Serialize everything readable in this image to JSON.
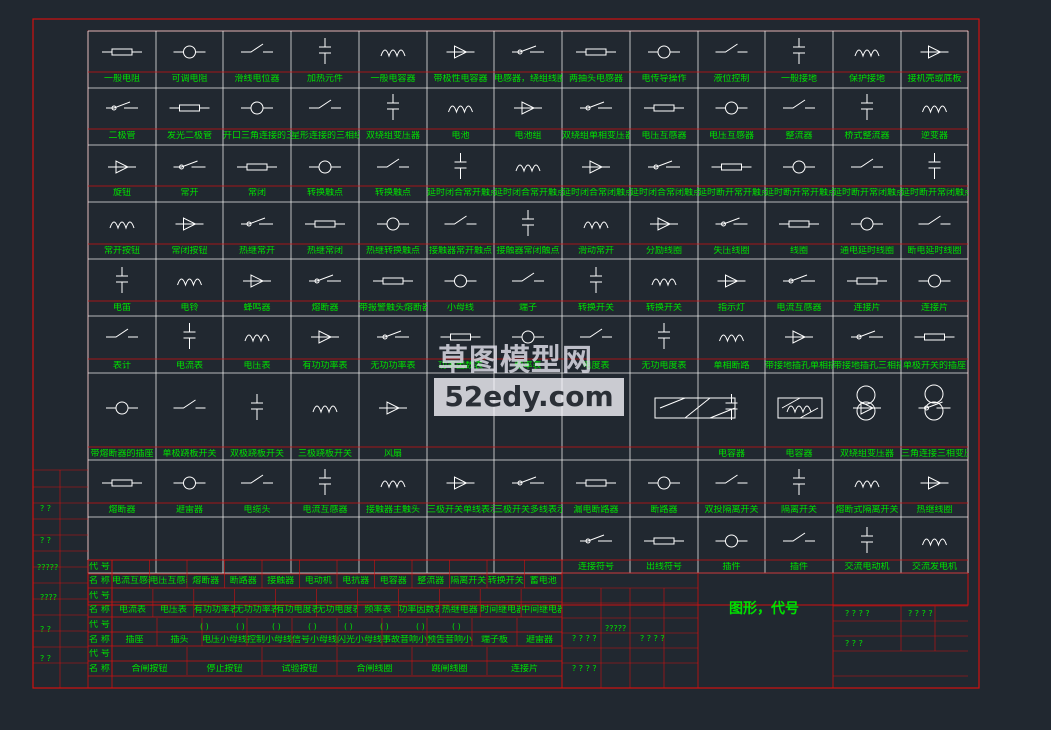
{
  "colors": {
    "background": "#212830",
    "frame": "#d01010",
    "grid": "#e8e8e8",
    "text": "#00e000",
    "symbol": "#ffffff"
  },
  "grid": {
    "rows": [
      [
        "一般电阻",
        "可调电阻",
        "滑线电位器",
        "加热元件",
        "一般电容器",
        "带极性电容器",
        "电感器，绕组线圈",
        "两抽头电感器",
        "电传导操作",
        "液位控制",
        "一般接地",
        "保护接地",
        "接机壳或底板"
      ],
      [
        "二极管",
        "发光二极管",
        "开口三角连接的三相绕组",
        "星形连接的三相绕组",
        "双绕组变压器",
        "电池",
        "电池组",
        "双绕组单相变压器",
        "电压互感器",
        "电压互感器",
        "整流器",
        "桥式整流器",
        "逆变器"
      ],
      [
        "旋钮",
        "常开",
        "常闭",
        "转换触点",
        "转换触点",
        "延时闭合常开触点",
        "延时闭合常开触点",
        "延时闭合常闭触点",
        "延时闭合常闭触点",
        "延时断开常开触点",
        "延时断开常开触点",
        "延时断开常闭触点",
        "延时断开常闭触点"
      ],
      [
        "常开按钮",
        "常闭按钮",
        "热继常开",
        "热继常闭",
        "热继转换触点",
        "接触器常开触点",
        "接触器常闭触点",
        "滑动常开",
        "分励线圈",
        "失压线圈",
        "线圈",
        "通电延时线圈",
        "断电延时线圈"
      ],
      [
        "电笛",
        "电铃",
        "蜂鸣器",
        "熔断器",
        "带报警触头熔断器",
        "小母线",
        "端子",
        "转换开关",
        "转换开关",
        "指示灯",
        "电流互感器",
        "连接片",
        "连接片"
      ],
      [
        "表计",
        "电流表",
        "电压表",
        "有功功率表",
        "无功功率表",
        "功率因数表",
        "频率表",
        "电度表",
        "无功电度表",
        "单相断路",
        "带接地插孔单相插座",
        "带接地插孔三相插座",
        "单极开关的插座"
      ],
      [
        "带熔断器的插座",
        "单极跷板开关",
        "双极跷板开关",
        "三极跷板开关",
        "风扇",
        "",
        "",
        "",
        "",
        "电容器",
        "电容器",
        "双绕组变压器",
        "三角连接三相变压器"
      ],
      [
        "熔断器",
        "避雷器",
        "电缆头",
        "电流互感器",
        "接触器主触头",
        "三极开关单线表示",
        "三极开关多线表示",
        "漏电断路器",
        "断路器",
        "双投隔离开关",
        "隔离开关",
        "熔断式隔离开关",
        "热继线圈"
      ],
      [
        "",
        "",
        "",
        "",
        "",
        "",
        "",
        "连接符号",
        "出线符号",
        "插件",
        "插件",
        "交流电动机",
        "交流发电机"
      ]
    ]
  },
  "bottom_table": {
    "code_label": "代 号",
    "name_label": "名 称",
    "rows": [
      [
        "电流互感器",
        "电压互感器",
        "熔断器",
        "断路器",
        "接触器",
        "电动机",
        "电抗器",
        "电容器",
        "整流器",
        "隔离开关",
        "转换开关",
        "蓄电池"
      ],
      [
        "电流表",
        "电压表",
        "有功功率表",
        "无功功率表",
        "有功电度表",
        "无功电度表",
        "频率表",
        "功率因数表",
        "热继电器",
        "时间继电器",
        "中间继电器"
      ],
      [
        "插座",
        "插头",
        "电压小母线",
        "控制小母线",
        "信号小母线",
        "闪光小母线",
        "事故音响小母线",
        "预告音响小母线",
        "端子板",
        "避雷器"
      ],
      [
        "合闸按钮",
        "停止按钮",
        "试验按钮",
        "合闸线圈",
        "跳闸线圈",
        "连接片"
      ]
    ],
    "brackets": [
      "( )",
      "( )",
      "( )",
      "( )",
      "( )",
      "( )",
      "( )",
      "( )"
    ]
  },
  "title_block": {
    "title": "图形，代号",
    "qmarks": [
      "? ? ? ?",
      "? ? ? ?",
      "? ? ?",
      "?????",
      "? ? ? ?",
      "? ? ? ?",
      "? ? ? ?"
    ]
  },
  "left_qmarks": [
    "?  ?",
    "?  ?",
    "?????",
    "????",
    "?  ?",
    "?  ?"
  ],
  "watermark": {
    "line1": "草图模型网",
    "line2": "52edy.com"
  }
}
